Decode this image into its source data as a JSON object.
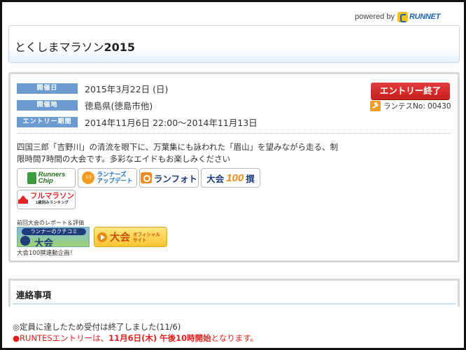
{
  "powered": {
    "label": "powered by",
    "brand": "RUNNET"
  },
  "title": {
    "name": "とくしまマラソン",
    "year": "2015"
  },
  "info": {
    "date_label": "開催日",
    "date_value": "2015年3月22日 (日)",
    "venue_label": "開催地",
    "venue_value": "徳島県(徳島市他)",
    "entry_label": "エントリー期間",
    "entry_value": "2014年11月6日  22:00〜2014年11月13日"
  },
  "entry_button": "エントリー終了",
  "runtes": "ランテスNo: 00430",
  "description": "四国三郎「吉野川」の清流を眼下に、万葉集にも詠われた「眉山」を望みながら走る、制限時間7時間の大会です。多彩なエイドもお楽しみください",
  "badges": {
    "chip_l1": "Runners",
    "chip_l2": "Chip",
    "app_l1": "ランナーズ",
    "app_l2": "アップデート",
    "foto": "ランフォト",
    "t100_a": "大会",
    "t100_b": "100",
    "t100_c": "撰",
    "full_main": "フルマラソン",
    "full_sub": "1歳刻みランキング"
  },
  "report": {
    "label": "前回大会のレポート＆評価",
    "banner_top": "ランナーのクチコミ",
    "banner_main": "大会",
    "official_main": "大会",
    "official_sub1": "オフィシャル",
    "official_sub2": "サイト",
    "note": "大会100撰連動企画！"
  },
  "notice": {
    "heading": "連絡事項",
    "line1": "◎定員に達したため受付は終了しました(11/6)",
    "line2_pre": "●RUNTESエントリーは、",
    "line2_bold": "11月6日(木) 午後10時開始",
    "line2_post": "となります。"
  },
  "colors": {
    "label_bg": "#6b9bd0",
    "entry_button": "#d42a2a",
    "notice_red": "#e01f1f",
    "title_gradient": "#e6f1fb"
  }
}
